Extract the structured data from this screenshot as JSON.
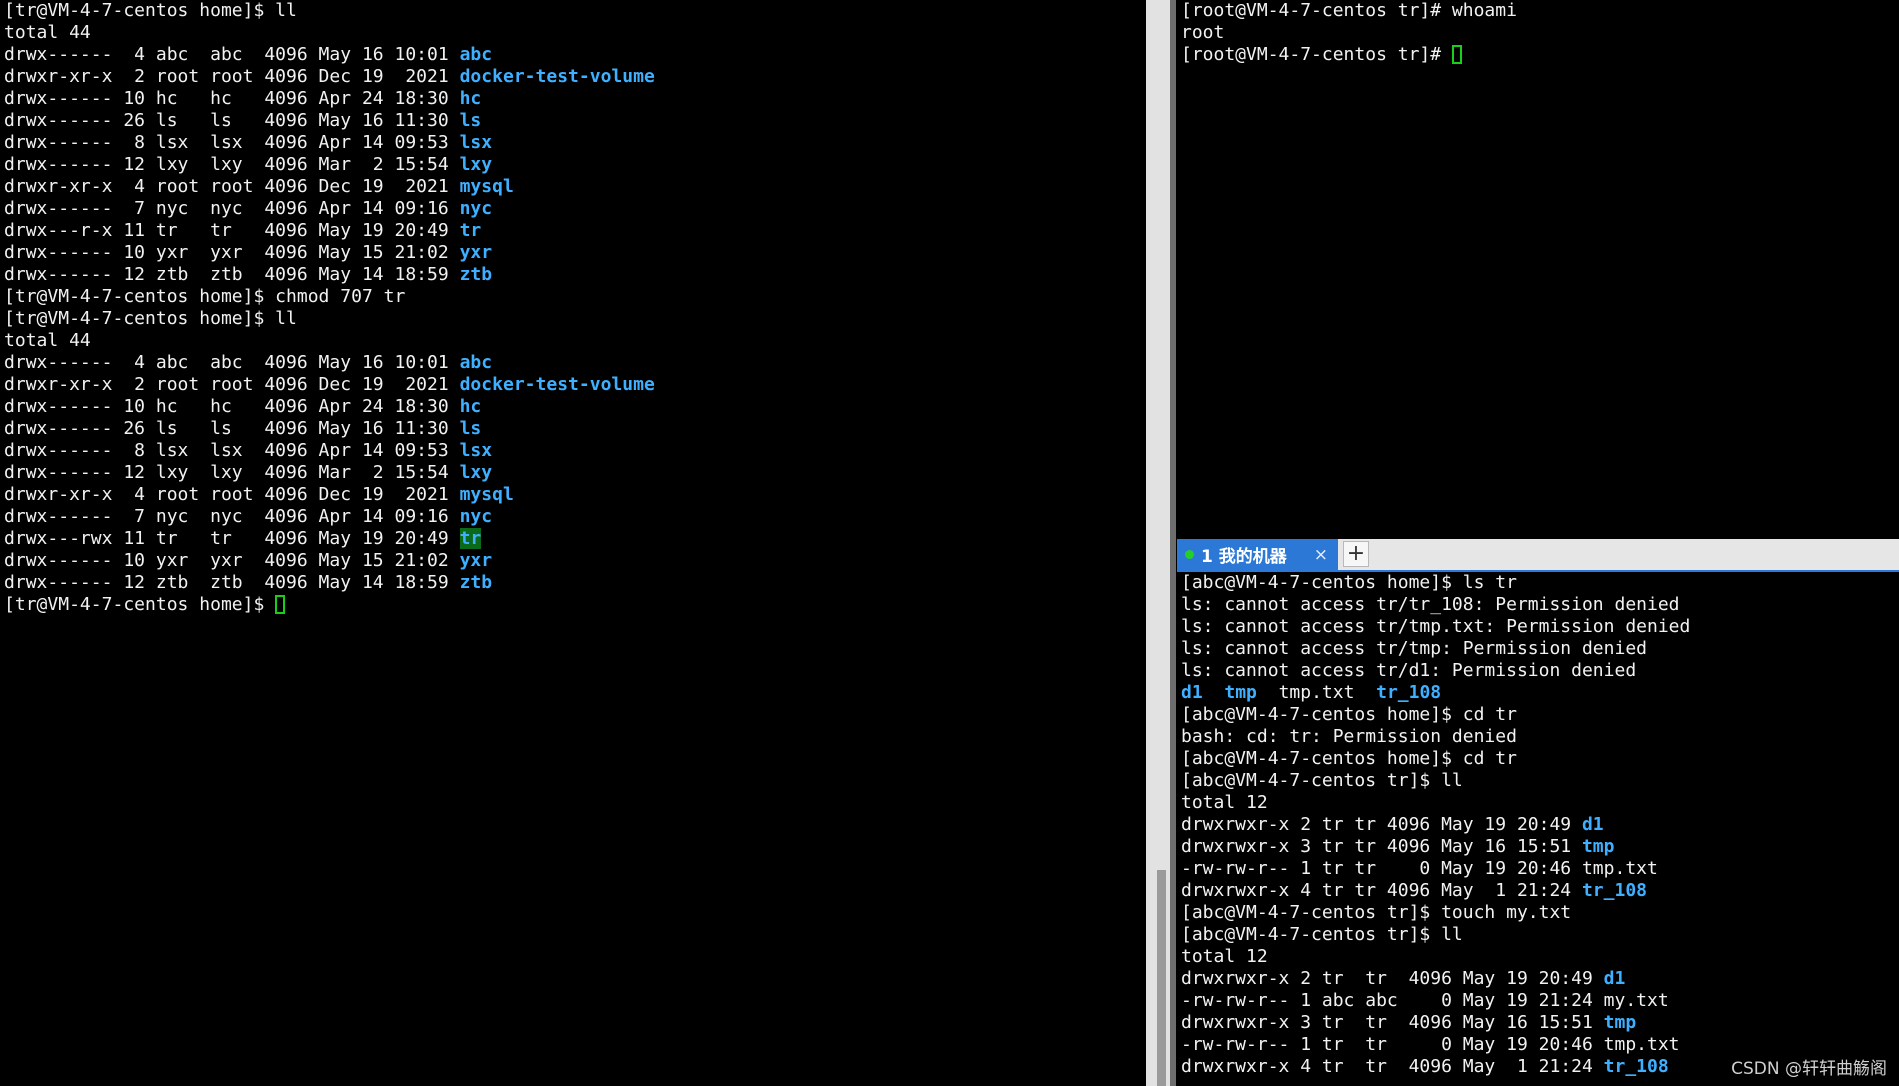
{
  "left_terminal": {
    "lines": [
      [
        {
          "t": "[tr@VM-4-7-centos home]$ ll"
        }
      ],
      [
        {
          "t": "total 44"
        }
      ],
      [
        {
          "t": "drwx------  4 abc  abc  4096 May 16 10:01 "
        },
        {
          "t": "abc",
          "c": "dir"
        }
      ],
      [
        {
          "t": "drwxr-xr-x  2 root root 4096 Dec 19  2021 "
        },
        {
          "t": "docker-test-volume",
          "c": "dir"
        }
      ],
      [
        {
          "t": "drwx------ 10 hc   hc   4096 Apr 24 18:30 "
        },
        {
          "t": "hc",
          "c": "dir"
        }
      ],
      [
        {
          "t": "drwx------ 26 ls   ls   4096 May 16 11:30 "
        },
        {
          "t": "ls",
          "c": "dir"
        }
      ],
      [
        {
          "t": "drwx------  8 lsx  lsx  4096 Apr 14 09:53 "
        },
        {
          "t": "lsx",
          "c": "dir"
        }
      ],
      [
        {
          "t": "drwx------ 12 lxy  lxy  4096 Mar  2 15:54 "
        },
        {
          "t": "lxy",
          "c": "dir"
        }
      ],
      [
        {
          "t": "drwxr-xr-x  4 root root 4096 Dec 19  2021 "
        },
        {
          "t": "mysql",
          "c": "dir"
        }
      ],
      [
        {
          "t": "drwx------  7 nyc  nyc  4096 Apr 14 09:16 "
        },
        {
          "t": "nyc",
          "c": "dir"
        }
      ],
      [
        {
          "t": "drwx---r-x 11 tr   tr   4096 May 19 20:49 "
        },
        {
          "t": "tr",
          "c": "dir"
        }
      ],
      [
        {
          "t": "drwx------ 10 yxr  yxr  4096 May 15 21:02 "
        },
        {
          "t": "yxr",
          "c": "dir"
        }
      ],
      [
        {
          "t": "drwx------ 12 ztb  ztb  4096 May 14 18:59 "
        },
        {
          "t": "ztb",
          "c": "dir"
        }
      ],
      [
        {
          "t": "[tr@VM-4-7-centos home]$ chmod 707 tr"
        }
      ],
      [
        {
          "t": "[tr@VM-4-7-centos home]$ ll"
        }
      ],
      [
        {
          "t": "total 44"
        }
      ],
      [
        {
          "t": "drwx------  4 abc  abc  4096 May 16 10:01 "
        },
        {
          "t": "abc",
          "c": "dir"
        }
      ],
      [
        {
          "t": "drwxr-xr-x  2 root root 4096 Dec 19  2021 "
        },
        {
          "t": "docker-test-volume",
          "c": "dir"
        }
      ],
      [
        {
          "t": "drwx------ 10 hc   hc   4096 Apr 24 18:30 "
        },
        {
          "t": "hc",
          "c": "dir"
        }
      ],
      [
        {
          "t": "drwx------ 26 ls   ls   4096 May 16 11:30 "
        },
        {
          "t": "ls",
          "c": "dir"
        }
      ],
      [
        {
          "t": "drwx------  8 lsx  lsx  4096 Apr 14 09:53 "
        },
        {
          "t": "lsx",
          "c": "dir"
        }
      ],
      [
        {
          "t": "drwx------ 12 lxy  lxy  4096 Mar  2 15:54 "
        },
        {
          "t": "lxy",
          "c": "dir"
        }
      ],
      [
        {
          "t": "drwxr-xr-x  4 root root 4096 Dec 19  2021 "
        },
        {
          "t": "mysql",
          "c": "dir"
        }
      ],
      [
        {
          "t": "drwx------  7 nyc  nyc  4096 Apr 14 09:16 "
        },
        {
          "t": "nyc",
          "c": "dir"
        }
      ],
      [
        {
          "t": "drwx---rwx 11 tr   tr   4096 May 19 20:49 "
        },
        {
          "t": "tr",
          "c": "dir hl"
        }
      ],
      [
        {
          "t": "drwx------ 10 yxr  yxr  4096 May 15 21:02 "
        },
        {
          "t": "yxr",
          "c": "dir"
        }
      ],
      [
        {
          "t": "drwx------ 12 ztb  ztb  4096 May 14 18:59 "
        },
        {
          "t": "ztb",
          "c": "dir"
        }
      ],
      [
        {
          "t": "[tr@VM-4-7-centos home]$ "
        },
        {
          "cursor": true
        }
      ]
    ]
  },
  "right_top_terminal": {
    "lines": [
      [
        {
          "t": "[root@VM-4-7-centos tr]# whoami"
        }
      ],
      [
        {
          "t": "root"
        }
      ],
      [
        {
          "t": "[root@VM-4-7-centos tr]# "
        },
        {
          "cursor": true
        }
      ]
    ]
  },
  "tab_bar": {
    "tab_label": "1 我的机器",
    "close_glyph": "×",
    "new_tab_glyph": "+"
  },
  "right_bottom_terminal": {
    "lines": [
      [
        {
          "t": "[abc@VM-4-7-centos home]$ ls tr"
        }
      ],
      [
        {
          "t": "ls: cannot access tr/tr_108: Permission denied"
        }
      ],
      [
        {
          "t": "ls: cannot access tr/tmp.txt: Permission denied"
        }
      ],
      [
        {
          "t": "ls: cannot access tr/tmp: Permission denied"
        }
      ],
      [
        {
          "t": "ls: cannot access tr/d1: Permission denied"
        }
      ],
      [
        {
          "t": "d1",
          "c": "dir"
        },
        {
          "t": "  "
        },
        {
          "t": "tmp",
          "c": "dir"
        },
        {
          "t": "  tmp.txt  "
        },
        {
          "t": "tr_108",
          "c": "dir"
        }
      ],
      [
        {
          "t": "[abc@VM-4-7-centos home]$ cd tr"
        }
      ],
      [
        {
          "t": "bash: cd: tr: Permission denied"
        }
      ],
      [
        {
          "t": "[abc@VM-4-7-centos home]$ cd tr"
        }
      ],
      [
        {
          "t": "[abc@VM-4-7-centos tr]$ ll"
        }
      ],
      [
        {
          "t": "total 12"
        }
      ],
      [
        {
          "t": "drwxrwxr-x 2 tr tr 4096 May 19 20:49 "
        },
        {
          "t": "d1",
          "c": "dir"
        }
      ],
      [
        {
          "t": "drwxrwxr-x 3 tr tr 4096 May 16 15:51 "
        },
        {
          "t": "tmp",
          "c": "dir"
        }
      ],
      [
        {
          "t": "-rw-rw-r-- 1 tr tr    0 May 19 20:46 tmp.txt"
        }
      ],
      [
        {
          "t": "drwxrwxr-x 4 tr tr 4096 May  1 21:24 "
        },
        {
          "t": "tr_108",
          "c": "dir"
        }
      ],
      [
        {
          "t": "[abc@VM-4-7-centos tr]$ touch my.txt"
        }
      ],
      [
        {
          "t": "[abc@VM-4-7-centos tr]$ ll"
        }
      ],
      [
        {
          "t": "total 12"
        }
      ],
      [
        {
          "t": "drwxrwxr-x 2 tr  tr  4096 May 19 20:49 "
        },
        {
          "t": "d1",
          "c": "dir"
        }
      ],
      [
        {
          "t": "-rw-rw-r-- 1 abc abc    0 May 19 21:24 my.txt"
        }
      ],
      [
        {
          "t": "drwxrwxr-x 3 tr  tr  4096 May 16 15:51 "
        },
        {
          "t": "tmp",
          "c": "dir"
        }
      ],
      [
        {
          "t": "-rw-rw-r-- 1 tr  tr     0 May 19 20:46 tmp.txt"
        }
      ],
      [
        {
          "t": "drwxrwxr-x 4 tr  tr  4096 May  1 21:24 "
        },
        {
          "t": "tr_108",
          "c": "dir"
        }
      ]
    ]
  },
  "watermark": "CSDN @轩轩曲觞阁",
  "colors": {
    "background": "#000000",
    "text": "#f2f2f2",
    "directory": "#3fb0ff",
    "highlight_bg": "#0a6a1a",
    "cursor": "#18d018",
    "tab_active": "#2b78d6"
  }
}
